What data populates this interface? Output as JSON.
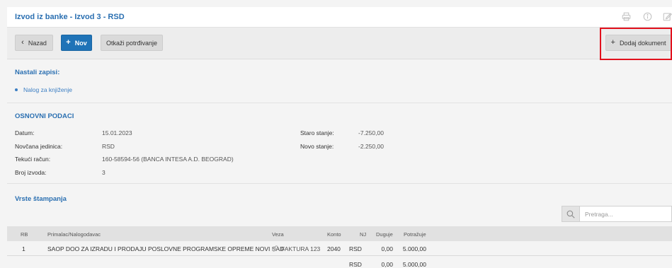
{
  "header": {
    "title": "Izvod iz banke - Izvod 3 - RSD"
  },
  "toolbar": {
    "back_label": "Nazad",
    "new_label": "Nov",
    "cancel_confirm_label": "Otkaži potrđivanje",
    "add_document_label": "Dodaj dokument"
  },
  "created_records": {
    "title": "Nastali zapisi:",
    "items": [
      "Nalog za knjiženje"
    ]
  },
  "basic_data": {
    "title": "OSNOVNI PODACI",
    "date_label": "Datum:",
    "date_value": "15.01.2023",
    "currency_label": "Novčana jedinica:",
    "currency_value": "RSD",
    "account_label": "Tekući račun:",
    "account_value": "160-58594-56 (BANCA INTESA A.D. BEOGRAD)",
    "statement_no_label": "Broj izvoda:",
    "statement_no_value": "3",
    "old_balance_label": "Staro stanje:",
    "old_balance_value": "-7.250,00",
    "new_balance_label": "Novo stanje:",
    "new_balance_value": "-2.250,00"
  },
  "print_types": {
    "title": "Vrste štampanja"
  },
  "search": {
    "placeholder": "Pretraga..."
  },
  "table": {
    "headers": {
      "rb": "RB",
      "party": "Primalac/Nalogodavac",
      "link": "Veza",
      "account": "Konto",
      "currency": "NJ",
      "debit": "Duguje",
      "credit": "Potražuje"
    },
    "rows": [
      {
        "rb": "1",
        "party": "SAOP DOO ZA IZRADU I PRODAJU POSLOVNE PROGRAMSKE OPREME NOVI SAD",
        "link": "FAKTURA 123",
        "account": "2040",
        "currency": "RSD",
        "debit": "0,00",
        "credit": "5.000,00"
      }
    ],
    "totals": {
      "currency": "RSD",
      "debit": "0,00",
      "credit": "5.000,00"
    }
  },
  "icons": {
    "print": "print-icon",
    "info": "info-icon",
    "edit": "edit-icon",
    "search": "search-icon",
    "link": "link-icon"
  },
  "colors": {
    "accent": "#2a6fb1",
    "primary_button": "#1f73b7",
    "highlight": "#e2111d"
  }
}
